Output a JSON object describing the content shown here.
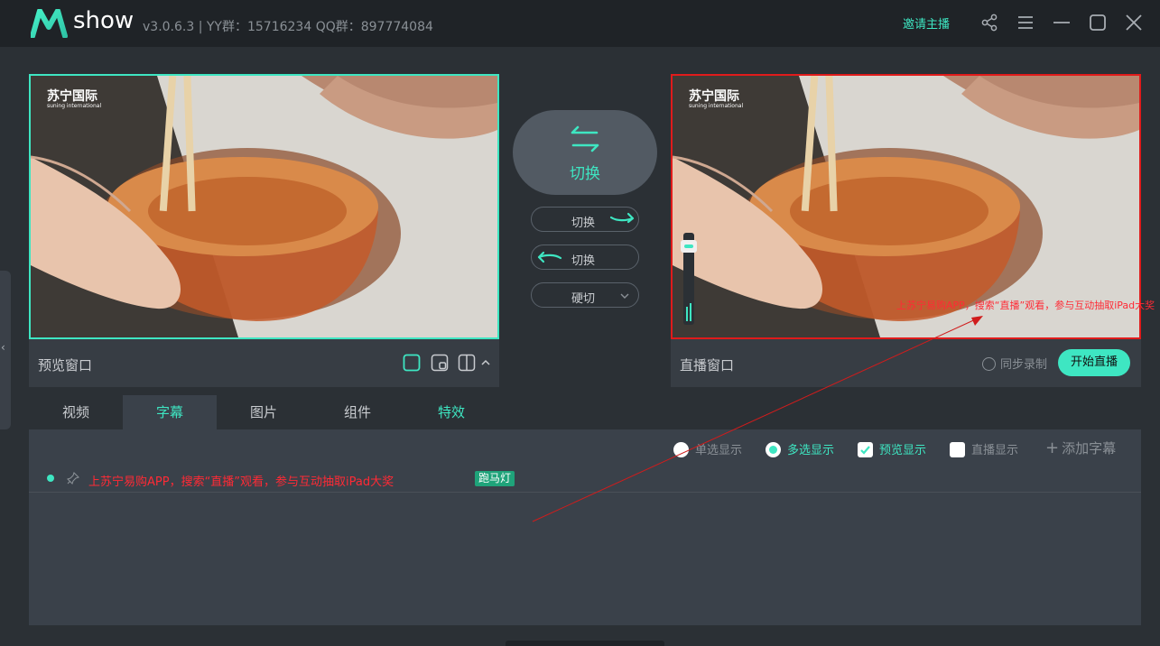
{
  "titlebar": {
    "logo_text": "show",
    "version_info": "v3.0.6.3 | YY群：15716234 QQ群：897774084",
    "invite_label": "邀请主播"
  },
  "watermark": {
    "brand": "苏宁国际",
    "brand_sub": "suning international"
  },
  "preview": {
    "label": "预览窗口"
  },
  "live": {
    "label": "直播窗口",
    "sync_record": "同步录制",
    "start_button": "开始直播"
  },
  "transitions": {
    "main_label": "切换",
    "to_live_label": "切换",
    "to_preview_label": "切换",
    "hard_cut_label": "硬切"
  },
  "ticker_preview": "上苏宁易购APP，搜索“直播”观看，参与互动抽取iPad大奖",
  "tabs": [
    {
      "label": "视频",
      "active": false
    },
    {
      "label": "字幕",
      "active": true
    },
    {
      "label": "图片",
      "active": false
    },
    {
      "label": "组件",
      "active": false
    },
    {
      "label": "特效",
      "active": false
    }
  ],
  "display_options": {
    "single": "单选显示",
    "multi": "多选显示",
    "preview": "预览显示",
    "live": "直播显示",
    "add_caption": "添加字幕"
  },
  "captions": [
    {
      "text": "上苏宁易购APP，搜索“直播”观看，参与互动抽取iPad大奖",
      "type": "跑马灯"
    }
  ],
  "colors": {
    "accent": "#3ee6c2",
    "live_border": "#e01b1b",
    "ticker_red": "#ff2a35"
  }
}
